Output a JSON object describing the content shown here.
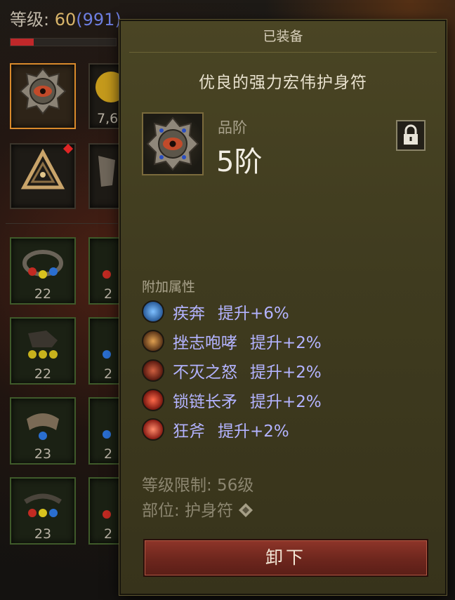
{
  "player": {
    "level_prefix": "等级: ",
    "level": "60",
    "paragon": "(991)",
    "xp_fill_fraction": 0.22
  },
  "inventory": {
    "slot_counts": [
      "22",
      "22",
      "23",
      "23"
    ],
    "partial_counts": [
      "2",
      "2",
      "2",
      "2"
    ],
    "top_slot_partial": "7,6"
  },
  "tooltip": {
    "header": "已装备",
    "item_name": "优良的强力宏伟护身符",
    "tier_label": "品阶",
    "tier_value": "5阶",
    "attributes_heading": "附加属性",
    "attributes": [
      {
        "name": "疾奔",
        "value": "提升+6%",
        "icon": "sprint-skill-icon",
        "color": "#3b7fc7"
      },
      {
        "name": "挫志咆哮",
        "value": "提升+2%",
        "icon": "demoralizing-roar-skill-icon",
        "color": "#8a5a2a"
      },
      {
        "name": "不灭之怒",
        "value": "提升+2%",
        "icon": "undying-rage-skill-icon",
        "color": "#9a2a1c"
      },
      {
        "name": "锁链长矛",
        "value": "提升+2%",
        "icon": "chain-spear-skill-icon",
        "color": "#b0241c"
      },
      {
        "name": "狂斧",
        "value": "提升+2%",
        "icon": "frenzy-axe-skill-icon",
        "color": "#c02a22"
      }
    ],
    "level_requirement": "等级限制: 56级",
    "slot": "部位: 护身符",
    "unequip_label": "卸下"
  },
  "colors": {
    "attribute_text": "#b3b3ff",
    "selected_slot_border": "#d98a2b",
    "unequip_button": "#7a2c22"
  }
}
